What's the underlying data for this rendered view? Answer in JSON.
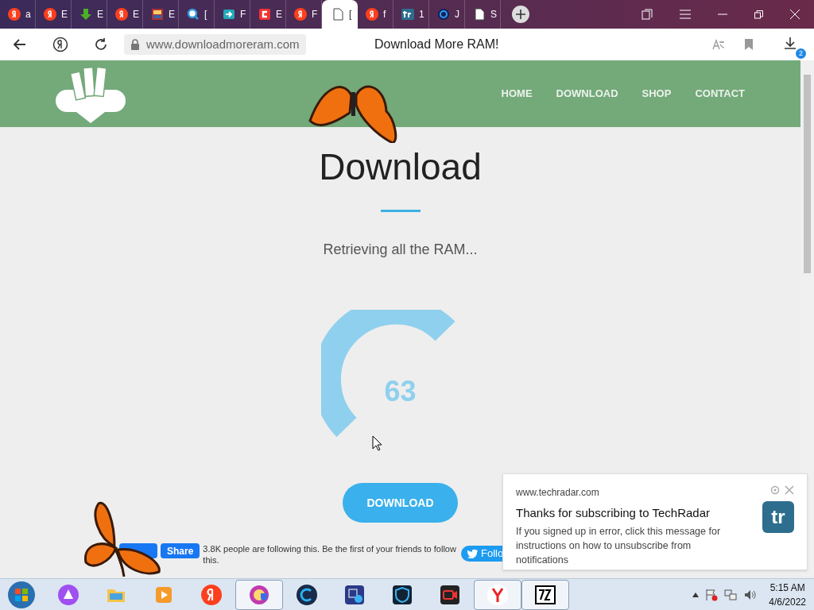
{
  "browser": {
    "tabs": [
      {
        "kind": "yandex",
        "label": "a",
        "selected": false
      },
      {
        "kind": "yandex",
        "label": "E",
        "selected": false
      },
      {
        "kind": "download",
        "label": "E",
        "selected": false
      },
      {
        "kind": "yandex",
        "label": "E",
        "selected": false
      },
      {
        "kind": "image",
        "label": "E",
        "selected": false
      },
      {
        "kind": "search",
        "label": "[",
        "selected": false
      },
      {
        "kind": "arrow",
        "label": "F",
        "selected": false
      },
      {
        "kind": "red",
        "label": "E",
        "selected": false
      },
      {
        "kind": "yandex",
        "label": "F",
        "selected": false
      },
      {
        "kind": "page",
        "label": "[",
        "selected": true
      },
      {
        "kind": "yandex",
        "label": "f",
        "selected": false
      },
      {
        "kind": "tr",
        "label": "1",
        "selected": false
      },
      {
        "kind": "shield",
        "label": "J",
        "selected": false
      },
      {
        "kind": "page",
        "label": "S",
        "selected": false
      }
    ],
    "address": "www.downloadmoreram.com",
    "page_title": "Download More RAM!",
    "downloads_badge": "2"
  },
  "site": {
    "nav": [
      "HOME",
      "DOWNLOAD",
      "SHOP",
      "CONTACT"
    ],
    "heading": "Download",
    "status": "Retrieving all the RAM...",
    "progress": "63",
    "button": "DOWNLOAD",
    "social": {
      "share": "Share",
      "follow_text": "3.8K people are following this. Be the first of your friends to follow this.",
      "twitter": "Follo"
    }
  },
  "notification": {
    "source": "www.techradar.com",
    "title": "Thanks for subscribing to TechRadar",
    "body": "If you signed up in error, click this message for instructions on how to unsubscribe from notifications",
    "logo": "tr"
  },
  "taskbar": {
    "apps": [
      {
        "kind": "alice",
        "active": false
      },
      {
        "kind": "folder",
        "active": false
      },
      {
        "kind": "player",
        "active": false
      },
      {
        "kind": "yandex",
        "active": false
      },
      {
        "kind": "shield-globe",
        "active": true
      },
      {
        "kind": "c",
        "active": false
      },
      {
        "kind": "photo",
        "active": false
      },
      {
        "kind": "vpn",
        "active": false
      },
      {
        "kind": "camera",
        "active": false
      },
      {
        "kind": "ybrowser",
        "active": true
      },
      {
        "kind": "sevenzip",
        "active": true
      }
    ],
    "time": "5:15 AM",
    "date": "4/6/2022"
  }
}
